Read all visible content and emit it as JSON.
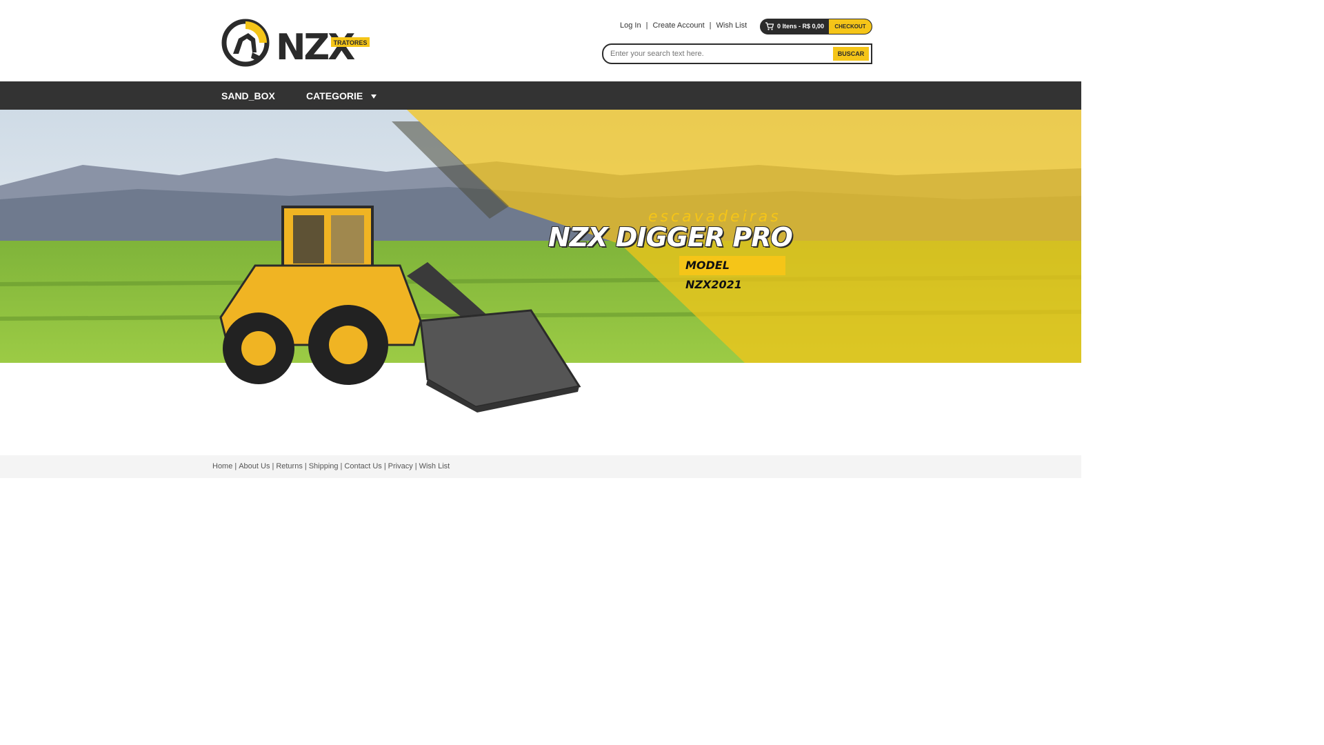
{
  "brand": {
    "name": "NZX",
    "tagline": "TRATORES"
  },
  "header": {
    "links": [
      {
        "label": "Log In"
      },
      {
        "label": "Create Account"
      },
      {
        "label": "Wish List"
      }
    ],
    "cart": {
      "summary": "0 Itens - R$ 0,00",
      "checkout_label": "CHECKOUT"
    },
    "search": {
      "placeholder": "Enter your search text here.",
      "button_label": "BUSCAR"
    }
  },
  "nav": {
    "items": [
      {
        "label": "SAND_BOX"
      },
      {
        "label": "CATEGORIE"
      }
    ]
  },
  "banner": {
    "subtitle": "escavadeiras",
    "title": "NZX DIGGER PRO",
    "model": "MODEL NZX2021"
  },
  "footer": {
    "links": [
      {
        "label": "Home"
      },
      {
        "label": "About Us"
      },
      {
        "label": "Returns"
      },
      {
        "label": "Shipping"
      },
      {
        "label": "Contact Us"
      },
      {
        "label": "Privacy"
      },
      {
        "label": "Wish List"
      }
    ]
  },
  "colors": {
    "accent": "#f5c518",
    "dark": "#2b2b2b",
    "nav": "#333333"
  }
}
